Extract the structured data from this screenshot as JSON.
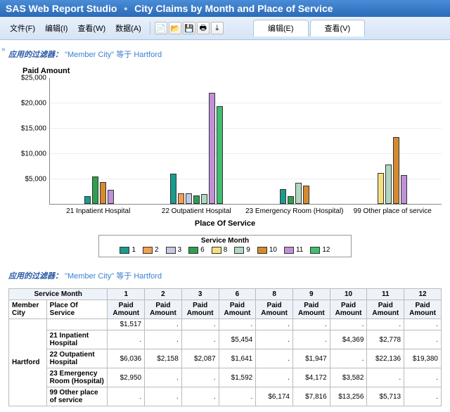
{
  "app": {
    "product": "SAS Web Report Studio",
    "report": "City Claims by Month and Place of Service"
  },
  "menu": {
    "file": "文件(F)",
    "edit": "编辑(I)",
    "view": "查看(W)",
    "data": "数据(A)"
  },
  "tabs": {
    "edit": "编辑(E)",
    "view": "查看(V)"
  },
  "filter": {
    "label": "应用的过滤器：",
    "cond": "\"Member City\" 等于 Hartford"
  },
  "chart": {
    "ytitle": "Paid Amount",
    "xtitle": "Place Of Service",
    "legend_title": "Service Month",
    "yticks": [
      "$25,000",
      "$20,000",
      "$15,000",
      "$10,000",
      "$5,000"
    ],
    "categories": [
      "21 Inpatient Hospital",
      "22 Outpatient Hospital",
      "23 Emergency Room (Hospital)",
      "99 Other place of service"
    ],
    "months": [
      "1",
      "2",
      "3",
      "6",
      "8",
      "9",
      "10",
      "11",
      "12"
    ]
  },
  "chart_data": {
    "type": "bar",
    "title": "Paid Amount",
    "xlabel": "Place Of Service",
    "ylabel": "Paid Amount",
    "ylim": [
      0,
      25000
    ],
    "categories": [
      "21 Inpatient Hospital",
      "22 Outpatient Hospital",
      "23 Emergency Room (Hospital)",
      "99 Other place of service"
    ],
    "series": [
      {
        "name": "1",
        "values": [
          1517,
          6036,
          2950,
          null
        ]
      },
      {
        "name": "2",
        "values": [
          null,
          2158,
          null,
          null
        ]
      },
      {
        "name": "3",
        "values": [
          null,
          2087,
          null,
          null
        ]
      },
      {
        "name": "6",
        "values": [
          5454,
          1641,
          1592,
          null
        ]
      },
      {
        "name": "8",
        "values": [
          null,
          null,
          null,
          6174
        ]
      },
      {
        "name": "9",
        "values": [
          null,
          1947,
          4172,
          7816
        ]
      },
      {
        "name": "10",
        "values": [
          4369,
          null,
          3582,
          13256
        ]
      },
      {
        "name": "11",
        "values": [
          2778,
          22136,
          null,
          5713
        ]
      },
      {
        "name": "12",
        "values": [
          null,
          19380,
          null,
          null
        ]
      }
    ]
  },
  "table": {
    "top_header": "Service Month",
    "col_member": "Member City",
    "col_place": "Place Of Service",
    "amount_label": "Paid Amount",
    "months": [
      "1",
      "2",
      "3",
      "6",
      "8",
      "9",
      "10",
      "11",
      "12"
    ],
    "city": "Hartford",
    "rows": [
      {
        "label": "",
        "vals": [
          "$1,517",
          ".",
          ".",
          ".",
          ".",
          ".",
          ".",
          ".",
          "."
        ]
      },
      {
        "label": "21 Inpatient Hospital",
        "vals": [
          ".",
          ".",
          ".",
          "$5,454",
          ".",
          ".",
          "$4,369",
          "$2,778",
          "."
        ]
      },
      {
        "label": "22 Outpatient Hospital",
        "vals": [
          "$6,036",
          "$2,158",
          "$2,087",
          "$1,641",
          ".",
          "$1,947",
          ".",
          "$22,136",
          "$19,380"
        ]
      },
      {
        "label": "23 Emergency Room (Hospital)",
        "vals": [
          "$2,950",
          ".",
          ".",
          "$1,592",
          ".",
          "$4,172",
          "$3,582",
          ".",
          "."
        ]
      },
      {
        "label": "99 Other place of service",
        "vals": [
          ".",
          ".",
          ".",
          ".",
          "$6,174",
          "$7,816",
          "$13,256",
          "$5,713",
          "."
        ]
      }
    ]
  }
}
